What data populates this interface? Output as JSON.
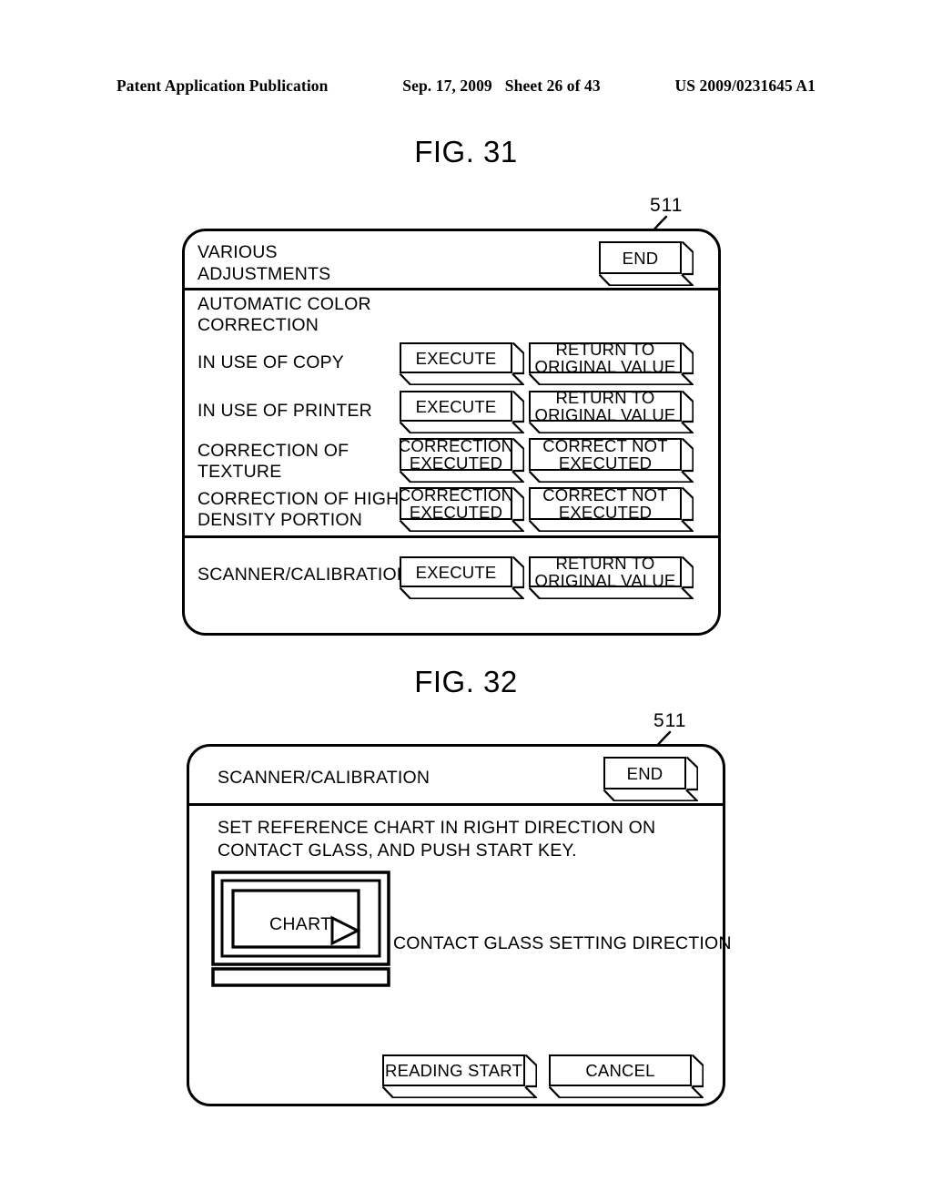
{
  "page_header": {
    "publication": "Patent Application Publication",
    "date": "Sep. 17, 2009",
    "sheet": "Sheet 26 of 43",
    "patent_number": "US 2009/0231645 A1"
  },
  "figures": [
    {
      "title": "FIG. 31",
      "reference_numeral": "511",
      "panel": {
        "header_title": "VARIOUS\nADJUSTMENTS",
        "end_button": "END",
        "section_title": "AUTOMATIC COLOR\nCORRECTION",
        "rows": [
          {
            "label": "IN USE OF COPY",
            "primary_button": "EXECUTE",
            "secondary_button": "RETURN TO\nORIGINAL VALUE"
          },
          {
            "label": "IN USE OF PRINTER",
            "primary_button": "EXECUTE",
            "secondary_button": "RETURN TO\nORIGINAL VALUE"
          },
          {
            "label": "CORRECTION OF\nTEXTURE",
            "primary_button": "CORRECTION\nEXECUTED",
            "secondary_button": "CORRECT NOT\nEXECUTED"
          },
          {
            "label": "CORRECTION OF HIGH\nDENSITY PORTION",
            "primary_button": "CORRECTION\nEXECUTED",
            "secondary_button": "CORRECT NOT\nEXECUTED"
          }
        ],
        "footer_row": {
          "label": "SCANNER/CALIBRATION",
          "primary_button": "EXECUTE",
          "secondary_button": "RETURN TO\nORIGINAL VALUE"
        }
      }
    },
    {
      "title": "FIG. 32",
      "reference_numeral": "511",
      "panel": {
        "header_title": "SCANNER/CALIBRATION",
        "end_button": "END",
        "instruction": "SET REFERENCE CHART IN RIGHT DIRECTION ON\nCONTACT GLASS, AND PUSH START KEY.",
        "chart_label": "CHART",
        "chart_caption": "CONTACT GLASS SETTING DIRECTION",
        "buttons": [
          {
            "label": "READING START"
          },
          {
            "label": "CANCEL"
          }
        ]
      }
    }
  ],
  "colors": {
    "ink": "#000000",
    "paper": "#ffffff"
  }
}
